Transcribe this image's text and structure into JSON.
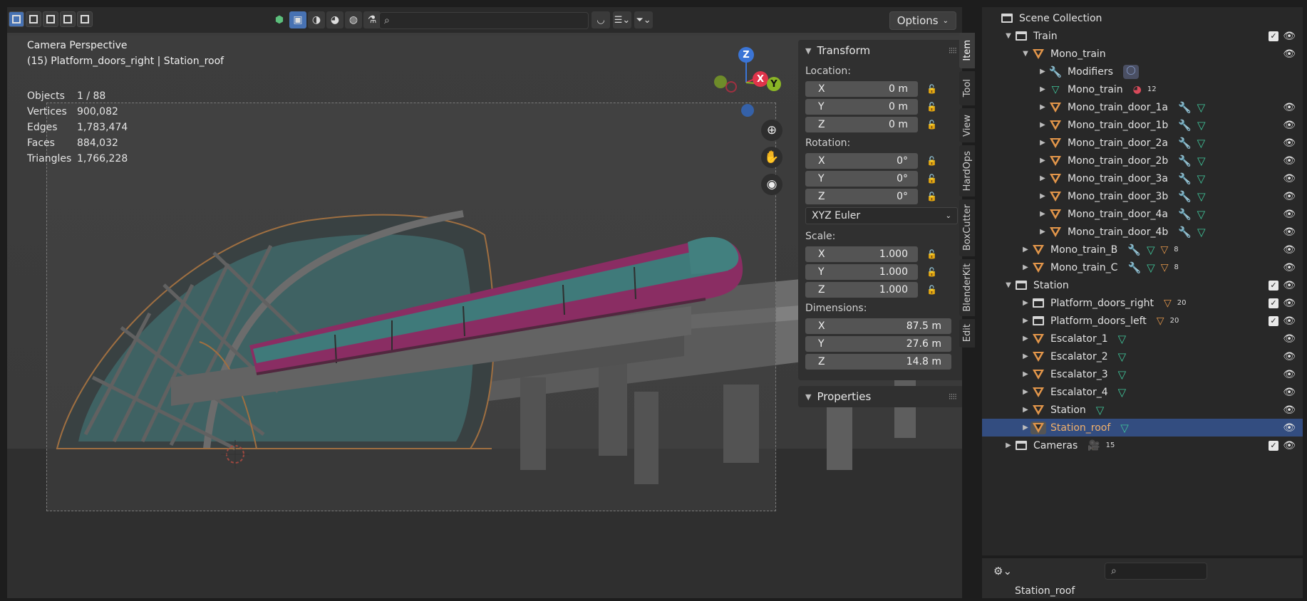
{
  "viewport": {
    "view_name": "Camera Perspective",
    "active_object": "(15) Platform_doors_right | Station_roof",
    "stats": [
      {
        "label": "Objects",
        "value": "1 / 88"
      },
      {
        "label": "Vertices",
        "value": "900,082"
      },
      {
        "label": "Edges",
        "value": "1,783,474"
      },
      {
        "label": "Faces",
        "value": "884,032"
      },
      {
        "label": "Triangles",
        "value": "1,766,228"
      }
    ],
    "options_label": "Options",
    "search_placeholder": "",
    "gizmo": {
      "z": "Z",
      "x": "X",
      "y": "Y"
    }
  },
  "npanel": {
    "transform_title": "Transform",
    "location_label": "Location:",
    "location": [
      {
        "axis": "X",
        "value": "0 m"
      },
      {
        "axis": "Y",
        "value": "0 m"
      },
      {
        "axis": "Z",
        "value": "0 m"
      }
    ],
    "rotation_label": "Rotation:",
    "rotation": [
      {
        "axis": "X",
        "value": "0°"
      },
      {
        "axis": "Y",
        "value": "0°"
      },
      {
        "axis": "Z",
        "value": "0°"
      }
    ],
    "rotation_mode": "XYZ Euler",
    "scale_label": "Scale:",
    "scale": [
      {
        "axis": "X",
        "value": "1.000"
      },
      {
        "axis": "Y",
        "value": "1.000"
      },
      {
        "axis": "Z",
        "value": "1.000"
      }
    ],
    "dimensions_label": "Dimensions:",
    "dimensions": [
      {
        "axis": "X",
        "value": "87.5 m"
      },
      {
        "axis": "Y",
        "value": "27.6 m"
      },
      {
        "axis": "Z",
        "value": "14.8 m"
      }
    ],
    "properties_title": "Properties",
    "tabs": [
      "Item",
      "Tool",
      "View",
      "HardOps",
      "BoxCutter",
      "BlenderKit",
      "Edit"
    ]
  },
  "outliner": {
    "rows": [
      {
        "label": "Scene Collection"
      },
      {
        "label": "Train"
      },
      {
        "label": "Mono_train"
      },
      {
        "label": "Modifiers"
      },
      {
        "label": "Mono_train",
        "badge": "12"
      },
      {
        "label": "Mono_train_door_1a"
      },
      {
        "label": "Mono_train_door_1b"
      },
      {
        "label": "Mono_train_door_2a"
      },
      {
        "label": "Mono_train_door_2b"
      },
      {
        "label": "Mono_train_door_3a"
      },
      {
        "label": "Mono_train_door_3b"
      },
      {
        "label": "Mono_train_door_4a"
      },
      {
        "label": "Mono_train_door_4b"
      },
      {
        "label": "Mono_train_B",
        "badge": "8"
      },
      {
        "label": "Mono_train_C",
        "badge": "8"
      },
      {
        "label": "Station"
      },
      {
        "label": "Platform_doors_right",
        "badge": "20"
      },
      {
        "label": "Platform_doors_left",
        "badge": "20"
      },
      {
        "label": "Escalator_1"
      },
      {
        "label": "Escalator_2"
      },
      {
        "label": "Escalator_3"
      },
      {
        "label": "Escalator_4"
      },
      {
        "label": "Station"
      },
      {
        "label": "Station_roof"
      },
      {
        "label": "Cameras",
        "badge": "15"
      }
    ],
    "bottom_label": "Station_roof"
  },
  "colors": {
    "accent": "#4772b3",
    "selection": "#334d80",
    "mesh": "#e3964a",
    "train_pink": "#c2187a",
    "glass_teal": "#3aa5a5"
  }
}
